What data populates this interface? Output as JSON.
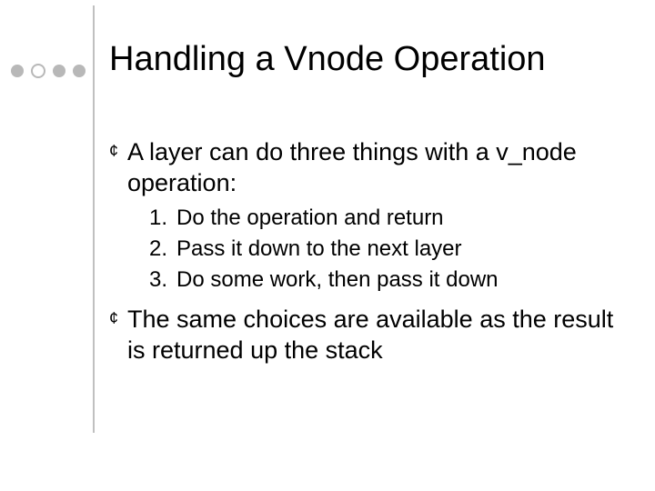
{
  "title": "Handling a Vnode Operation",
  "bullets": [
    {
      "text": "A layer can do three things with a v_node operation:",
      "sub": [
        {
          "num": "1.",
          "text": "Do the operation and return"
        },
        {
          "num": "2.",
          "text": "Pass it down to the next layer"
        },
        {
          "num": "3.",
          "text": "Do some work, then pass it down"
        }
      ]
    },
    {
      "text": "The same choices are available as the result is returned up the stack"
    }
  ]
}
